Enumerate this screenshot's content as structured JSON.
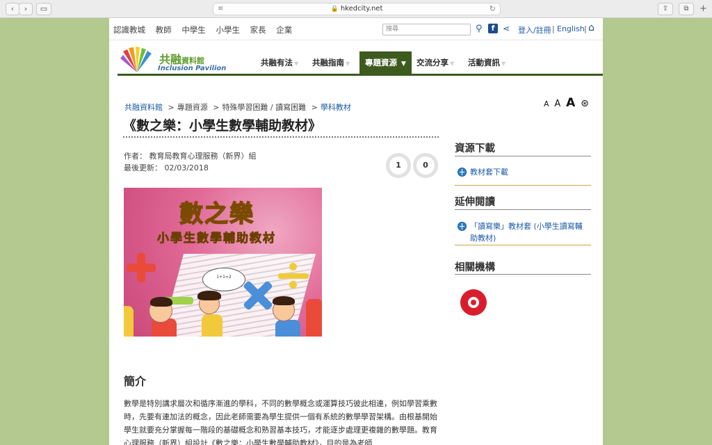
{
  "browser": {
    "url": "hkedcity.net",
    "back": "‹",
    "forward": "›",
    "new_tab": "+"
  },
  "topbar": {
    "links": [
      "認識教城",
      "教師",
      "中學生",
      "小學生",
      "家長",
      "企業"
    ],
    "search_placeholder": "搜尋",
    "login": "登入/註冊",
    "separator": "|",
    "english": "English"
  },
  "logo": {
    "cn_main": "共融",
    "cn_small": "資料館",
    "en": "Inclusion Pavilion"
  },
  "nav": {
    "items": [
      "共融有法",
      "共融指南",
      "專題資源",
      "交流分享",
      "活動資訊"
    ],
    "active_index": 2,
    "active_arrow": "▼",
    "arrow": "▼",
    "active_color": "#3d5a1f"
  },
  "breadcrumb": {
    "items": [
      "共融資料館",
      "專題資源",
      "特殊學習困難 / 讀寫困難",
      "學科教材"
    ],
    "separator": ">"
  },
  "font_size_controls": [
    "A",
    "A",
    "A"
  ],
  "article": {
    "title": "《數之樂：小學生數學輔助教材》",
    "author_label": "作者：",
    "author": "教育局教育心理服務（新界）組",
    "updated_label": "最後更新：",
    "updated": "02/03/2018",
    "counter_1": "1",
    "counter_2": "0",
    "cover_title": "數之樂",
    "cover_subtitle": "小學生數學輔助教材",
    "cover_speech": "1+1=2",
    "intro_heading": "簡介",
    "intro_text": "數學是特別講求層次和循序漸進的學科，不同的數學概念或運算技巧彼此相連，例如學習乘數時，先要有連加法的概念，因此老師需要為學生提供一個有系統的數學學習架構。由根基開始學生就要充分掌握每一階段的基礎概念和熟習基本技巧，才能逐步處理更複雜的數學題。教育心理服務（新界）組設計《數之樂：小學生數學輔助教材》，目的是為老師"
  },
  "sidebar": {
    "downloads_heading": "資源下載",
    "download_link": "教材套下載",
    "reading_heading": "延伸閱讀",
    "reading_link": "「讀寫樂」教材套 (小學生讀寫輔助教材)",
    "orgs_heading": "相關機構"
  },
  "colors": {
    "page_bg": "#b3c98f",
    "link": "#1a5aa8",
    "nav_dark_green": "#3d5a1f"
  }
}
